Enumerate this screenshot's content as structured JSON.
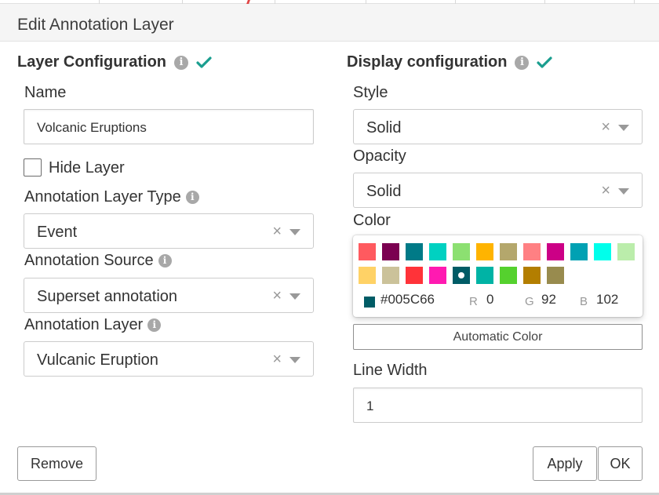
{
  "modal": {
    "title": "Edit Annotation Layer"
  },
  "layer_config": {
    "title": "Layer Configuration",
    "name_label": "Name",
    "name_value": "Volcanic Eruptions",
    "hide_layer_label": "Hide Layer",
    "hide_layer_checked": false,
    "type_label": "Annotation Layer Type",
    "type_value": "Event",
    "source_label": "Annotation Source",
    "source_value": "Superset annotation",
    "layer_label": "Annotation Layer",
    "layer_value": "Vulcanic Eruption"
  },
  "display_config": {
    "title": "Display configuration",
    "style_label": "Style",
    "style_value": "Solid",
    "opacity_label": "Opacity",
    "opacity_value": "Solid",
    "color_label": "Color",
    "swatches": [
      "#ff5a5f",
      "#7b0051",
      "#007a87",
      "#00d1c1",
      "#8ce071",
      "#ffb400",
      "#b4a76c",
      "#ff8083",
      "#cc0086",
      "#00a1b3",
      "#00ffeb",
      "#bbedab",
      "#ffd266",
      "#cbc29a",
      "#ff3339",
      "#ff1ab1",
      "#005c66",
      "#00b3a5",
      "#55d12e",
      "#b37e00",
      "#988b4e"
    ],
    "selected_color": "#005C66",
    "hex": "#005C66",
    "r_label": "R",
    "r_value": "0",
    "g_label": "G",
    "g_value": "92",
    "b_label": "B",
    "b_value": "102",
    "auto_color_label": "Automatic Color",
    "line_width_label": "Line Width",
    "line_width_value": "1"
  },
  "footer": {
    "remove_label": "Remove",
    "apply_label": "Apply",
    "ok_label": "OK"
  },
  "colors": {
    "accent": "#1a9e8f",
    "info": "#a8a8a8"
  },
  "icons": {
    "info": "info-icon",
    "check": "check-icon",
    "clear": "clear-icon",
    "caret": "caret-down-icon"
  }
}
